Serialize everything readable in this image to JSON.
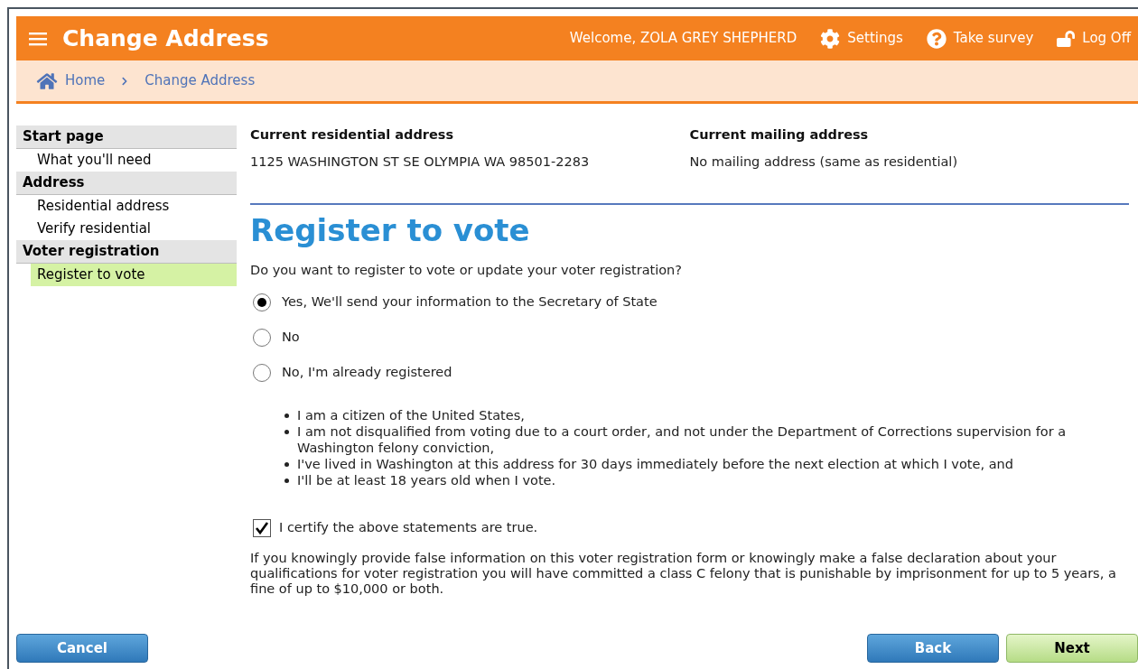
{
  "header": {
    "title": "Change Address",
    "welcome": "Welcome, ZOLA GREY SHEPHERD",
    "actions": [
      {
        "kind": "settings",
        "label": "Settings"
      },
      {
        "kind": "help",
        "label": "Take survey"
      },
      {
        "kind": "logoff",
        "label": "Log Off"
      }
    ]
  },
  "breadcrumb": [
    "Home",
    "Change Address"
  ],
  "sidebar": [
    {
      "label": "Start page",
      "children": [
        {
          "label": "What you'll need",
          "selected": false
        }
      ]
    },
    {
      "label": "Address",
      "children": [
        {
          "label": "Residential address",
          "selected": false
        },
        {
          "label": "Verify residential",
          "selected": false
        }
      ]
    },
    {
      "label": "Voter registration",
      "children": [
        {
          "label": "Register to vote",
          "selected": true
        }
      ]
    }
  ],
  "addresses": [
    {
      "label": "Current residential address",
      "value": "1125 WASHINGTON ST SE OLYMPIA WA 98501-2283"
    },
    {
      "label": "Current mailing address",
      "value": "No mailing address (same as residential)"
    }
  ],
  "heading": "Register to vote",
  "question": "Do you want to register to vote or update your voter registration?",
  "options": [
    {
      "label": "Yes, We'll send your information to the Secretary of State",
      "selected": true
    },
    {
      "label": "No",
      "selected": false
    },
    {
      "label": "No, I'm already registered",
      "selected": false
    }
  ],
  "statements": [
    "I am a citizen of the United States,",
    "I am not disqualified from voting due to a court order, and not under the Department of Corrections supervision for a Washington felony conviction,",
    "I've lived in Washington at this address for 30 days immediately before the next election at which I vote, and",
    "I'll be at least 18 years old when I vote."
  ],
  "certify": {
    "label": "I certify the above statements are true.",
    "checked": true
  },
  "warning": "If you knowingly provide false information on this voter registration form or knowingly make a false declaration about your qualifications for voter registration you will have committed a class C felony that is punishable by imprisonment for up to 5 years, a fine of up to $10,000 or both.",
  "buttons": [
    {
      "kind": "secondary",
      "label": "Cancel"
    },
    {
      "kind": "secondary",
      "label": "Back"
    },
    {
      "kind": "primary",
      "label": "Next"
    }
  ]
}
